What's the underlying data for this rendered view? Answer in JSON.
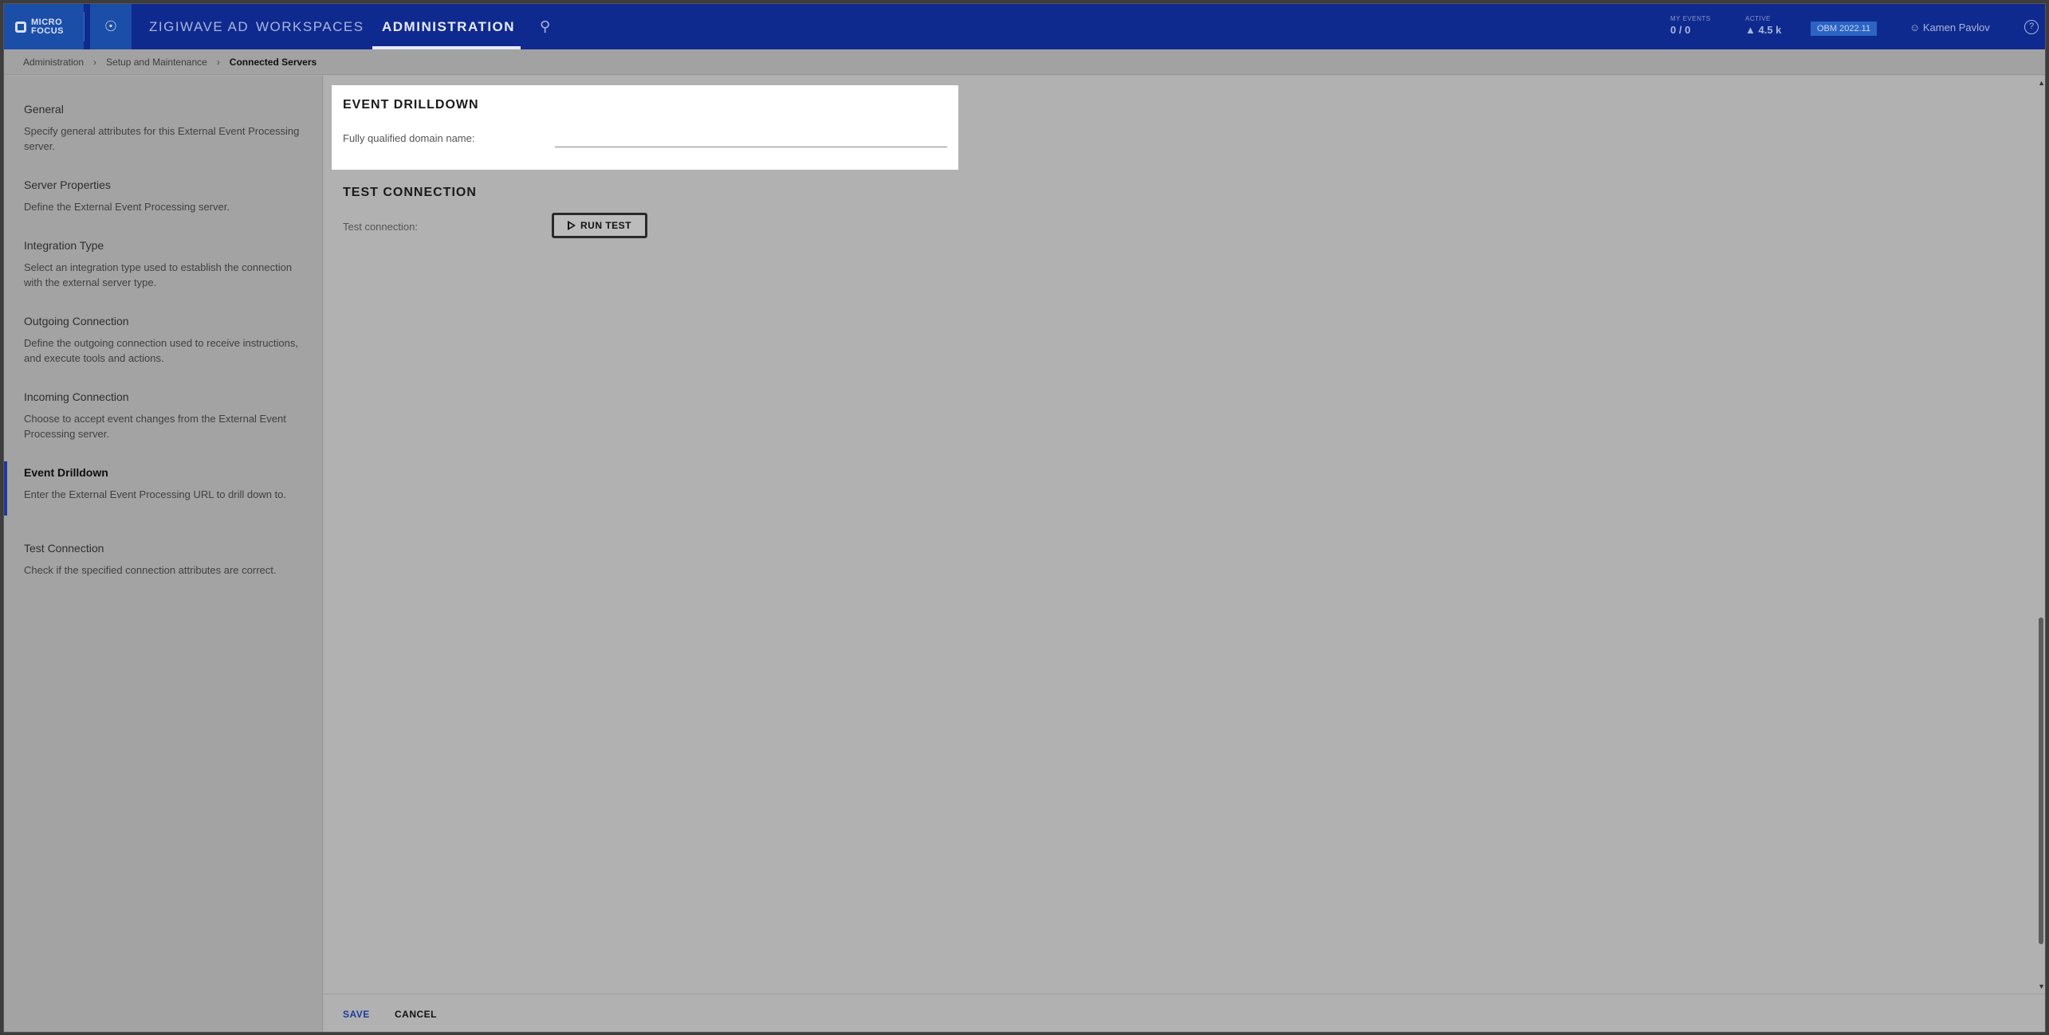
{
  "topbar": {
    "logo_text": "MICRO FOCUS",
    "nav": [
      "ZIGIWAVE AD",
      "WORKSPACES",
      "ADMINISTRATION"
    ],
    "metrics": [
      {
        "label": "MY EVENTS",
        "value": "0 / 0"
      },
      {
        "label": "ACTIVE",
        "value": "4.5 k"
      }
    ],
    "version": "OBM 2022.11",
    "user": "Kamen Pavlov",
    "help": "?"
  },
  "breadcrumb": {
    "items": [
      "Administration",
      "Setup and Maintenance",
      "Connected Servers"
    ]
  },
  "sidenav": {
    "steps": [
      {
        "title": "General",
        "desc": "Specify general attributes for this External Event Processing server."
      },
      {
        "title": "Server Properties",
        "desc": "Define the External Event Processing server."
      },
      {
        "title": "Integration Type",
        "desc": "Select an integration type used to establish the connection with the external server type."
      },
      {
        "title": "Outgoing Connection",
        "desc": "Define the outgoing connection used to receive instructions, and execute tools and actions."
      },
      {
        "title": "Incoming Connection",
        "desc": "Choose to accept event changes from the External Event Processing server."
      },
      {
        "title": "Event Drilldown",
        "desc": "Enter the External Event Processing URL to drill down to."
      },
      {
        "title": "Test Connection",
        "desc": "Check if the specified connection attributes are correct."
      }
    ]
  },
  "main": {
    "drilldown": {
      "title": "EVENT DRILLDOWN",
      "fqdn_label": "Fully qualified domain name:",
      "fqdn_value": ""
    },
    "test": {
      "title": "TEST CONNECTION",
      "label": "Test connection:",
      "button": "RUN TEST"
    }
  },
  "footer": {
    "save": "SAVE",
    "cancel": "CANCEL"
  },
  "colors": {
    "nav_bg": "#0f2a8f",
    "accent": "#1d3a9c",
    "save": "#1d3a9c"
  }
}
